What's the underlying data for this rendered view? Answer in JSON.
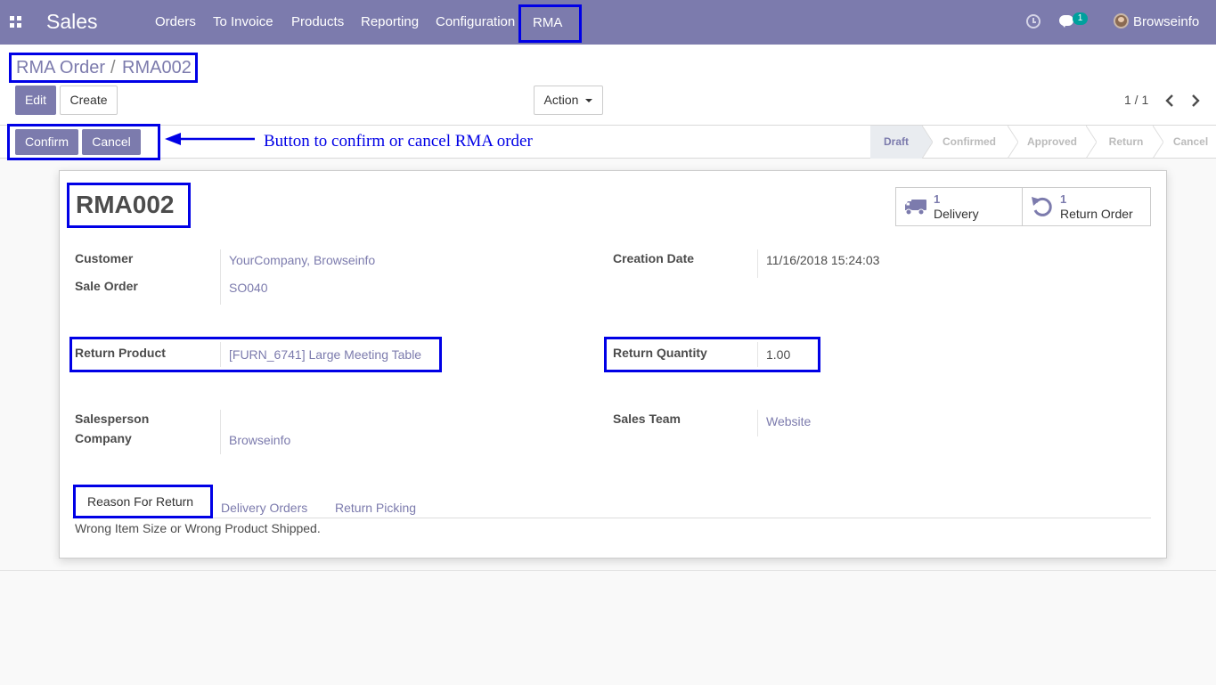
{
  "navbar": {
    "app_name": "Sales",
    "menu": [
      "Orders",
      "To Invoice",
      "Products",
      "Reporting",
      "Configuration"
    ],
    "rma_label": "RMA",
    "chat_count": "1",
    "user_name": "Browseinfo",
    "icons": [
      "apps-icon",
      "clock-icon",
      "chat-icon",
      "avatar"
    ]
  },
  "breadcrumb": {
    "parent": "RMA Order",
    "separator": "/",
    "current": "RMA002"
  },
  "toolbar": {
    "edit_label": "Edit",
    "create_label": "Create",
    "action_label": "Action"
  },
  "pager": {
    "value": "1 / 1"
  },
  "status_buttons": {
    "confirm_label": "Confirm",
    "cancel_label": "Cancel"
  },
  "annotation": {
    "text": "Button to confirm or cancel RMA order"
  },
  "stages": {
    "items": [
      "Draft",
      "Confirmed",
      "Approved",
      "Return",
      "Cancel"
    ],
    "active": "Draft"
  },
  "record": {
    "title": "RMA002",
    "smart_buttons": [
      {
        "count": "1",
        "label": "Delivery",
        "icon": "truck-icon"
      },
      {
        "count": "1",
        "label": "Return Order",
        "icon": "undo-icon"
      }
    ],
    "fields": {
      "customer_label": "Customer",
      "customer_value": "YourCompany, Browseinfo",
      "sale_order_label": "Sale Order",
      "sale_order_value": "SO040",
      "creation_date_label": "Creation Date",
      "creation_date_value": "11/16/2018 15:24:03",
      "return_product_label": "Return Product",
      "return_product_value": "[FURN_6741] Large Meeting Table",
      "return_quantity_label": "Return Quantity",
      "return_quantity_value": "1.00",
      "salesperson_label": "Salesperson",
      "company_label": "Company",
      "company_value": "Browseinfo",
      "sales_team_label": "Sales Team",
      "sales_team_value": "Website"
    },
    "tabs": [
      "Reason For Return",
      "Delivery Orders",
      "Return Picking"
    ],
    "reason_text": "Wrong Item Size or Wrong Product Shipped."
  },
  "colors": {
    "primary": "#7c7bad",
    "annotation": "#0000e6",
    "badge": "#00a09d"
  }
}
